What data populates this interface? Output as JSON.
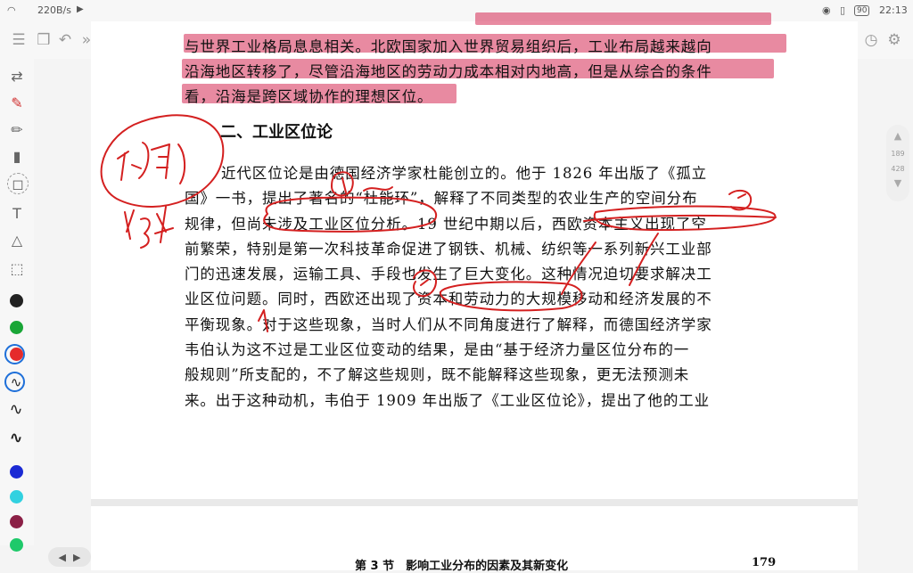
{
  "status_bar": {
    "net_speed": "220B/s",
    "time": "22:13",
    "battery": "90"
  },
  "toolbar": {
    "left": [
      "list-icon",
      "layers-icon",
      "undo-icon",
      "more-icon"
    ],
    "right": [
      "fill-icon",
      "add-page-icon",
      "page-icon",
      "history-icon",
      "settings-icon"
    ]
  },
  "sidebar": {
    "colors": [
      "#222222",
      "#1aa637",
      "#e52b2b",
      "#1b2ad4",
      "#32d1e0",
      "#8b2046",
      "#1fc96a"
    ],
    "selected_color": "#e52b2b"
  },
  "scroll": {
    "current_page": "189",
    "total_pages": "428"
  },
  "document": {
    "lines": [
      "与世界工业格局息息相关。北欧国家加入世界贸易组织后，工业布局越来越向",
      "沿海地区转移了，尽管沿海地区的劳动力成本相对内地高，但是从综合的条件",
      "看，沿海是跨区域协作的理想区位。"
    ],
    "heading": "二、工业区位论",
    "paragraph": [
      "近代区位论是由德国经济学家杜能创立的。他于 1826 年出版了《孤立",
      "国》一书，提出了著名的“杜能环”，解释了不同类型的农业生产的空间分布",
      "规律，但尚未涉及工业区位分析。19 世纪中期以后，西欧资本主义出现了空",
      "前繁荣，特别是第一次科技革命促进了钢铁、机械、纺织等一系列新兴工业部",
      "门的迅速发展，运输工具、手段也发生了巨大变化。这种情况迫切要求解决工",
      "业区位问题。同时，西欧还出现了资本和劳动力的大规模移动和经济发展的不",
      "平衡现象。对于这些现象，当时人们从不同角度进行了解释，而德国经济学家",
      "韦伯认为这不过是工业区位变动的结果，是由“基于经济力量区位分布的一",
      "般规则”所支配的，不了解这些规则，既不能解释这些现象，更无法预测未",
      "来。出于这种动机，韦伯于 1909 年出版了《工业区位论》，提出了他的工业"
    ],
    "footer": {
      "section": "第 3 节　影响工业分布的因素及其新变化",
      "page_number": "179"
    }
  }
}
